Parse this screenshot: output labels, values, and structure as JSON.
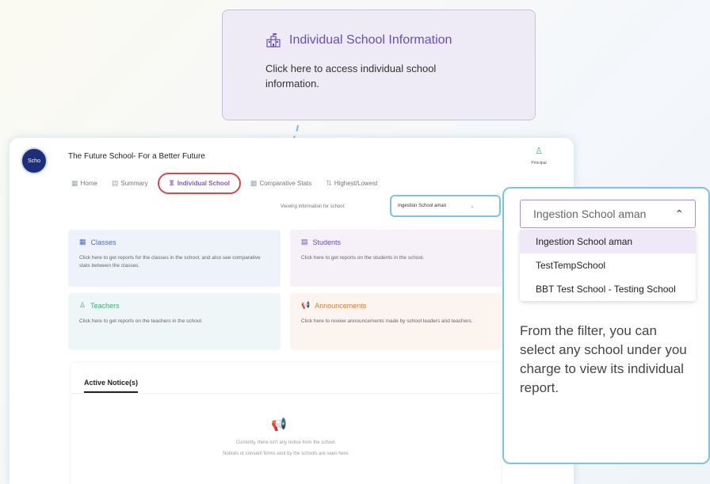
{
  "tooltip": {
    "title": "Individual School Information",
    "body": "Click here to access individual school information."
  },
  "header": {
    "logo_text": "Scho",
    "school_name": "The Future School- For a Better Future",
    "profile_role": "Principal"
  },
  "tabs": [
    {
      "label": "Home",
      "icon": "grid-icon"
    },
    {
      "label": "Summary",
      "icon": "summary-icon"
    },
    {
      "label": "Individual School",
      "icon": "school-icon"
    },
    {
      "label": "Comparative Stats",
      "icon": "stats-icon"
    },
    {
      "label": "Highest/Lowest",
      "icon": "rank-icon"
    }
  ],
  "filter": {
    "viewing_label": "Viewing information for school:",
    "selected_school": "Ingestion School aman"
  },
  "cards": {
    "classes": {
      "title": "Classes",
      "desc": "Click here to get reports for the classes in the school, and also see comparative stats between the classes."
    },
    "students": {
      "title": "Students",
      "desc": "Click here to get reports on the students in the school."
    },
    "teachers": {
      "title": "Teachers",
      "desc": "Click here to get reports on the teachers in the school."
    },
    "announcements": {
      "title": "Announcements",
      "desc": "Click here to review announcements made by school leaders and teachers."
    }
  },
  "notices": {
    "tab_label": "Active Notice(s)",
    "empty_line1": "Currently, there isn't any notice from the school.",
    "empty_line2": "Notices or consent forms sent by the schools are seen here."
  },
  "dropdown": {
    "placeholder": "Ingestion School aman",
    "options": [
      "Ingestion School aman",
      "TestTempSchool",
      "BBT Test School - Testing School"
    ],
    "description": "From the filter, you can select any school under you charge to view its individual report."
  },
  "colors": {
    "accent_purple": "#6a4fb0",
    "highlight_red": "#d9474f",
    "highlight_blue": "#7ec3e6"
  }
}
